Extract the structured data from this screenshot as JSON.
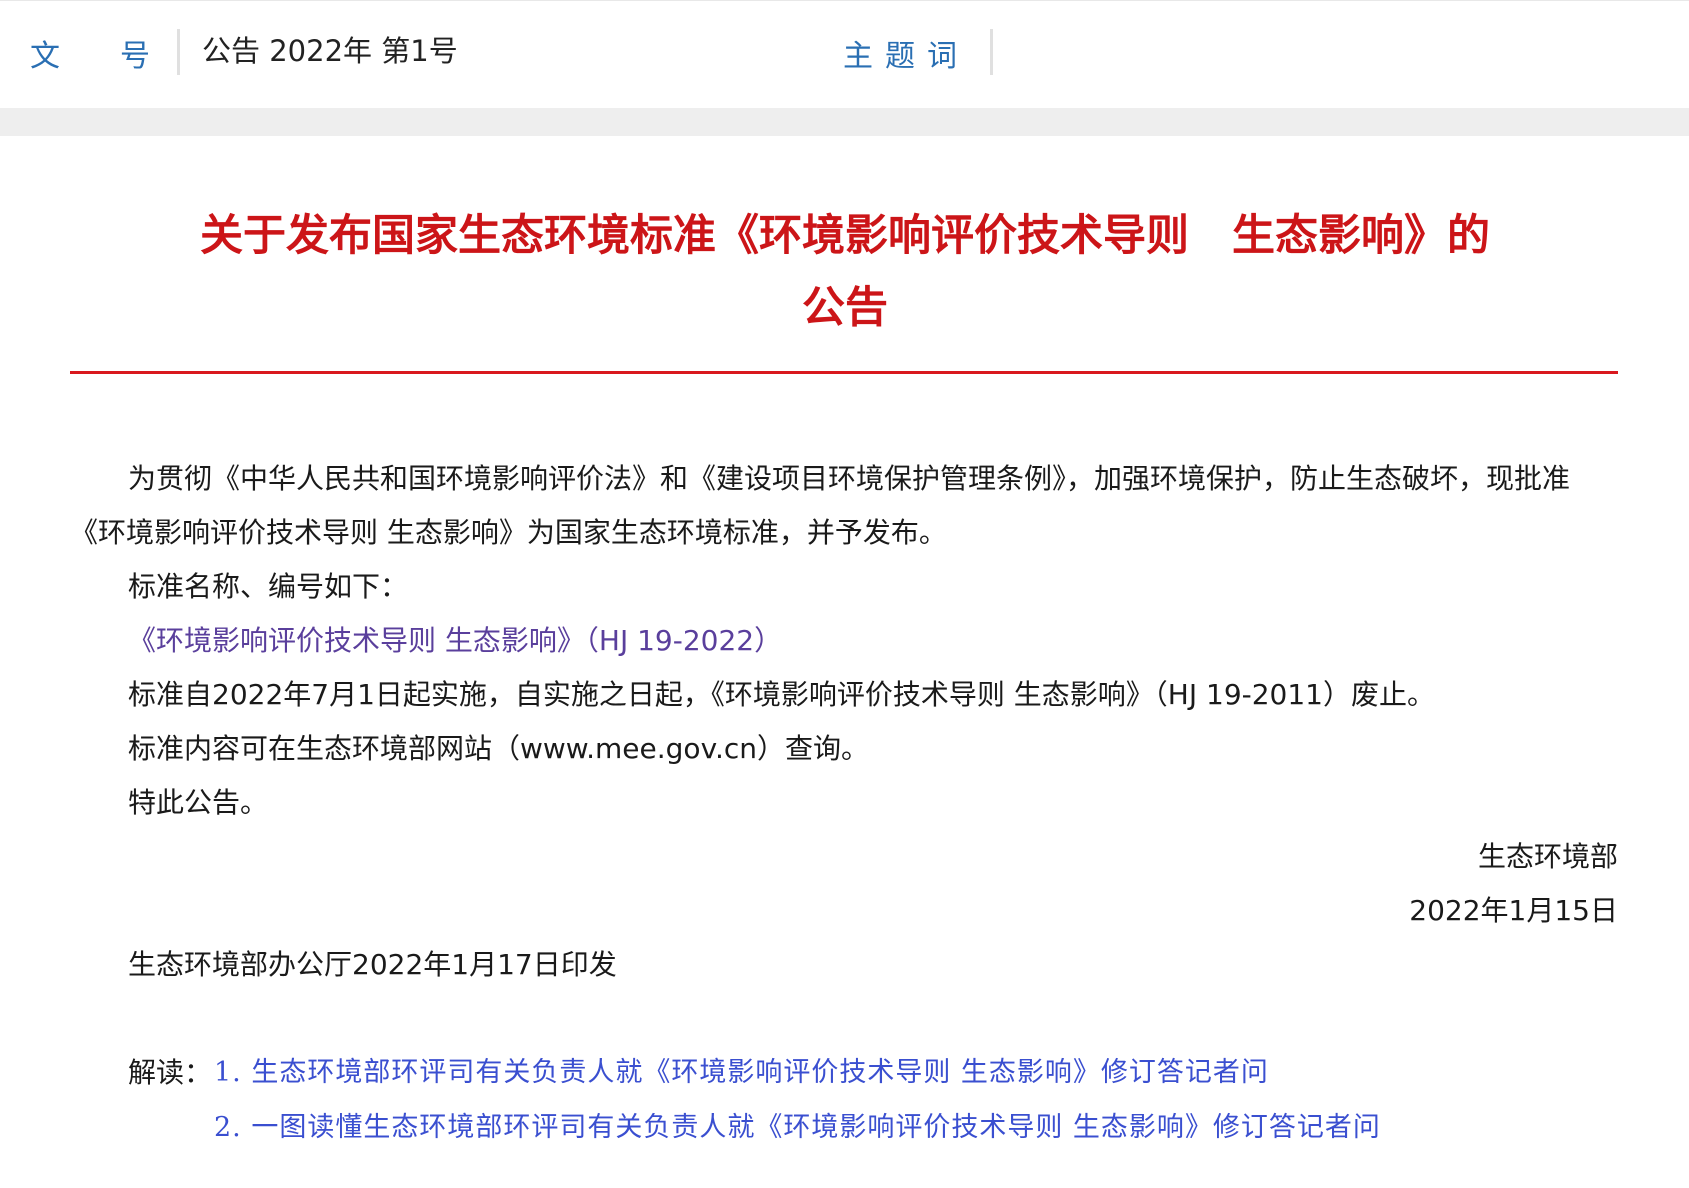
{
  "header": {
    "doc_no_label_1": "文",
    "doc_no_label_2": "号",
    "doc_no_value": "公告 2022年 第1号",
    "subject_label": "主题词"
  },
  "title": {
    "line1": "关于发布国家生态环境标准《环境影响评价技术导则　生态影响》的",
    "line2": "公告"
  },
  "body": {
    "lead": "为贯彻《中华人民共和国环境影响评价法》和《建设项目环境保护管理条例》，加强环境保护，防止生态破坏，现批准《环境影响评价技术导则 生态影响》为国家生态环境标准，并予发布。",
    "names_heading": "标准名称、编号如下：",
    "standard_link": "《环境影响评价技术导则 生态影响》（HJ 19-2022）",
    "effective": "标准自2022年7月1日起实施，自实施之日起，《环境影响评价技术导则 生态影响》（HJ 19-2011）废止。",
    "website": "标准内容可在生态环境部网站（www.mee.gov.cn）查询。",
    "notice": "特此公告。"
  },
  "signature": {
    "org": "生态环境部",
    "date": "2022年1月15日"
  },
  "issued": "生态环境部办公厅2022年1月17日印发",
  "interpretation": {
    "label": "解读：",
    "links": [
      "1. 生态环境部环评司有关负责人就《环境影响评价技术导则 生态影响》修订答记者问",
      "2. 一图读懂生态环境部环评司有关负责人就《环境影响评价技术导则 生态影响》修订答记者问"
    ]
  },
  "colors": {
    "title_red": "#cc1518",
    "label_blue": "#2a6fb3",
    "link_purple": "#5a3f9c",
    "link_blue": "#3a4fd0"
  }
}
